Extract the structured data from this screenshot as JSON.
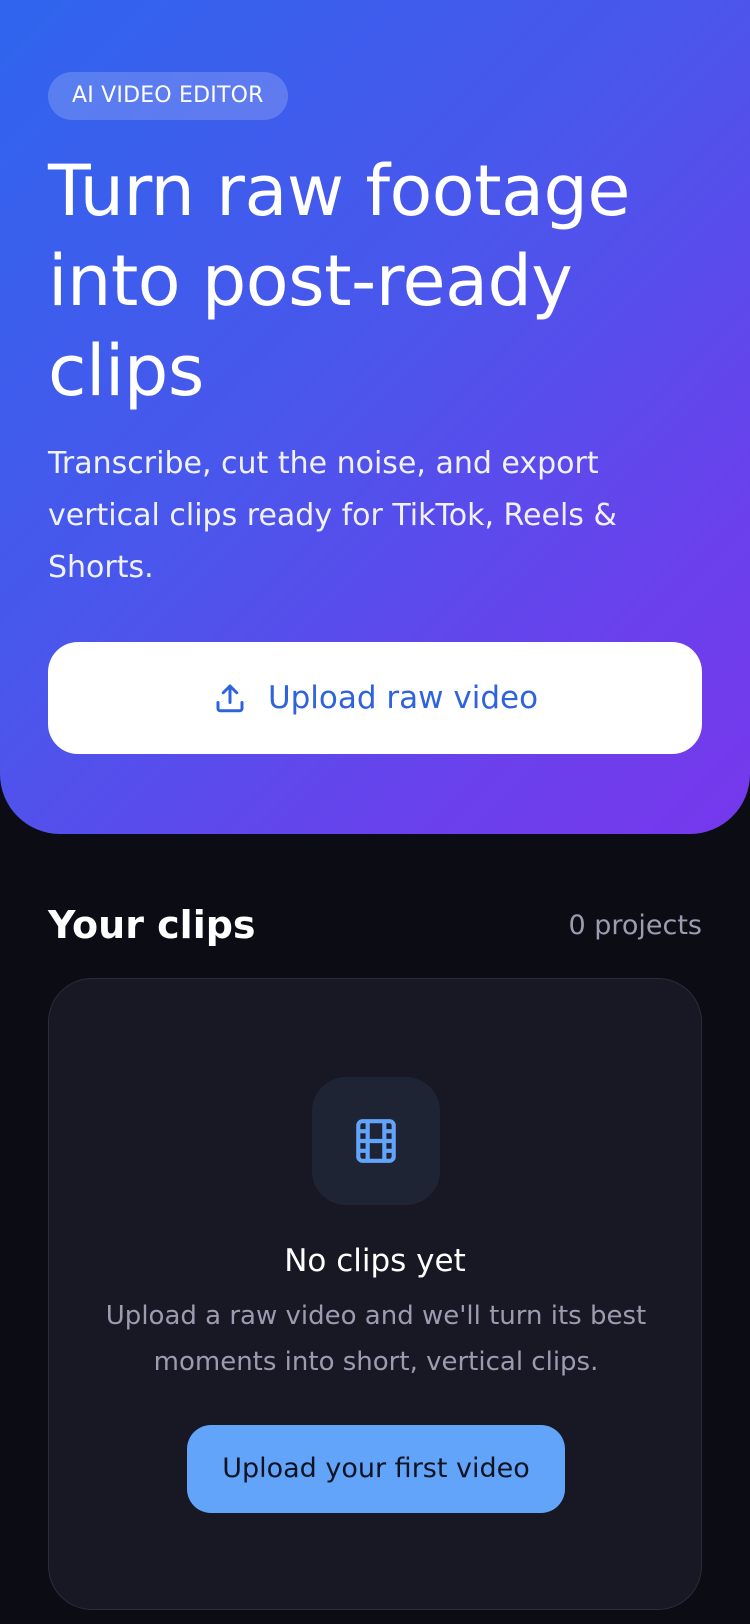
{
  "hero": {
    "badge": "AI VIDEO EDITOR",
    "title": "Turn raw footage into post-ready clips",
    "subtitle": "Transcribe, cut the noise, and export vertical clips ready for TikTok, Reels & Shorts.",
    "upload_button": {
      "label": "Upload raw video",
      "icon": "upload-icon"
    }
  },
  "clips": {
    "title": "Your clips",
    "count": "0 projects",
    "empty_state": {
      "icon": "film-icon",
      "title": "No clips yet",
      "description": "Upload a raw video and we'll turn its best moments into short, vertical clips.",
      "cta_label": "Upload your first video"
    }
  },
  "colors": {
    "hero_gradient_start": "#2f65ee",
    "hero_gradient_end": "#7638ec",
    "background": "#0b0c14",
    "card": "#171823",
    "accent": "#62a4f9",
    "upload_label": "#2f63dd"
  }
}
